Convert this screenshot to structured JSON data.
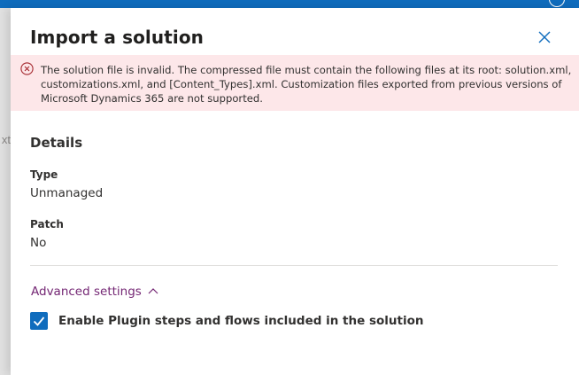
{
  "dialog": {
    "title": "Import a solution",
    "close_icon": "close-icon"
  },
  "error": {
    "icon": "error-circle-icon",
    "message": "The solution file is invalid. The compressed file must contain the following files at its root: solution.xml, customizations.xml, and [Content_Types].xml. Customization files exported from previous versions of Microsoft Dynamics 365 are not supported."
  },
  "details": {
    "heading": "Details",
    "type_label": "Type",
    "type_value": "Unmanaged",
    "patch_label": "Patch",
    "patch_value": "No"
  },
  "advanced": {
    "label": "Advanced settings",
    "icon": "chevron-up-icon",
    "expanded": true
  },
  "plugin_option": {
    "label": "Enable Plugin steps and flows included in the solution",
    "checked": true
  },
  "background": {
    "partial_text": "xt"
  },
  "colors": {
    "accent": "#0f6cbd",
    "error_bg": "#fde7e9",
    "error_icon": "#a4262c",
    "link": "#742774"
  }
}
